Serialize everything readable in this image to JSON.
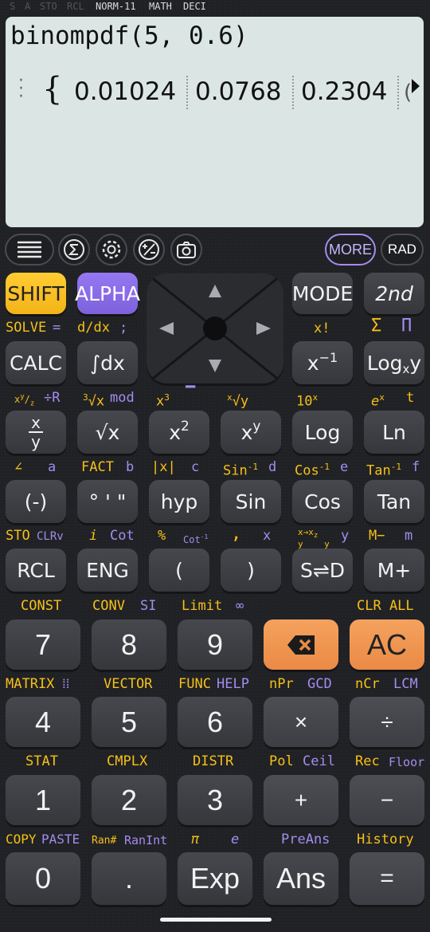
{
  "status": {
    "s": "S",
    "a": "A",
    "sto": "STO",
    "rcl": "RCL",
    "mode": "NORM-11",
    "math": "MATH",
    "deci": "DECI"
  },
  "display": {
    "expression": "binompdf(5, 0.6)",
    "results": [
      "0.01024",
      "0.0768",
      "0.2304"
    ]
  },
  "toolbar": {
    "more": "MORE",
    "rad": "RAD"
  },
  "keys": {
    "shift": "SHIFT",
    "alpha": "ALPHA",
    "mode": "MODE",
    "second": "2nd",
    "calc": "CALC",
    "int_dx": "∫dx",
    "log_xy": "Log",
    "sqrt": "√x",
    "log": "Log",
    "ln": "Ln",
    "neg": "(-)",
    "dms": "° ' \"",
    "hyp": "hyp",
    "sin": "Sin",
    "cos": "Cos",
    "tan": "Tan",
    "rcl": "RCL",
    "eng": "ENG",
    "lparen": "(",
    "rparen": ")",
    "sd": "S⇌D",
    "mplus": "M+",
    "n7": "7",
    "n8": "8",
    "n9": "9",
    "ac": "AC",
    "n4": "4",
    "n5": "5",
    "n6": "6",
    "mul": "×",
    "div": "÷",
    "n1": "1",
    "n2": "2",
    "n3": "3",
    "add": "+",
    "sub": "−",
    "n0": "0",
    "dot": ".",
    "exp": "Exp",
    "ans": "Ans",
    "eq": "="
  },
  "labels": {
    "solve": "SOLVE",
    "solve_eq": "=",
    "ddx": "d/dx",
    "semicolon": ";",
    "xfact": "x!",
    "sigma": "Σ",
    "pi_prod": "Π",
    "div_r": "÷R",
    "mod": "mod",
    "ten_x": "10",
    "e_x": "e",
    "t": "t",
    "angle": "∠",
    "a": "a",
    "fact": "FACT",
    "b": "b",
    "abs": "|x|",
    "c": "c",
    "sin_inv": "Sin",
    "d": "d",
    "cos_inv": "Cos",
    "e": "e",
    "tan_inv": "Tan",
    "f": "f",
    "sto": "STO",
    "clrv": "CLRv",
    "i": "i",
    "cot": "Cot",
    "percent": "%",
    "cot_inv": "Cot",
    "comma": ",",
    "x": "x",
    "y": "y",
    "m_minus": "M−",
    "m": "m",
    "const": "CONST",
    "conv": "CONV",
    "si": "SI",
    "limit": "Limit",
    "infinity": "∞",
    "clr_all": "CLR ALL",
    "matrix": "MATRIX",
    "vector": "VECTOR",
    "func": "FUNC",
    "help": "HELP",
    "npr": "nPr",
    "gcd": "GCD",
    "ncr": "nCr",
    "lcm": "LCM",
    "stat": "STAT",
    "cmplx": "CMPLX",
    "distr": "DISTR",
    "pol": "Pol",
    "ceil": "Ceil",
    "rec": "Rec",
    "floor": "Floor",
    "copy": "COPY",
    "paste": "PASTE",
    "ran_hash": "Ran#",
    "ranint": "RanInt",
    "pi": "π",
    "e_const": "e",
    "preans": "PreAns",
    "history": "History"
  }
}
